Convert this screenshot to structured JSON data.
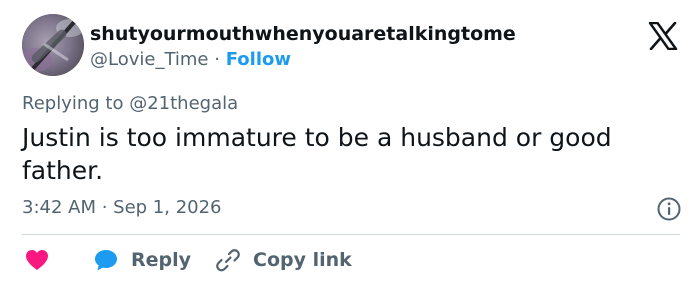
{
  "tweet": {
    "display_name": "shutyourmouthwhenyouaretalkingtome",
    "handle": "@Lovie_Time",
    "separator": "·",
    "follow_label": "Follow",
    "replying_to": "Replying to @21thegala",
    "text": "Justin is too immature to be a husband or good father.",
    "timestamp": "3:42 AM · Sep 1, 2026"
  },
  "actions": {
    "reply_label": "Reply",
    "copy_link_label": "Copy link"
  },
  "colors": {
    "accent": "#1d9bf0",
    "like": "#f91880",
    "text": "#0f1419",
    "muted": "#536471",
    "divider": "#cfd9de"
  },
  "icons": {
    "logo": "x-logo-icon",
    "info": "info-icon",
    "like": "heart-icon",
    "reply": "reply-bubble-icon",
    "copy_link": "link-icon"
  }
}
